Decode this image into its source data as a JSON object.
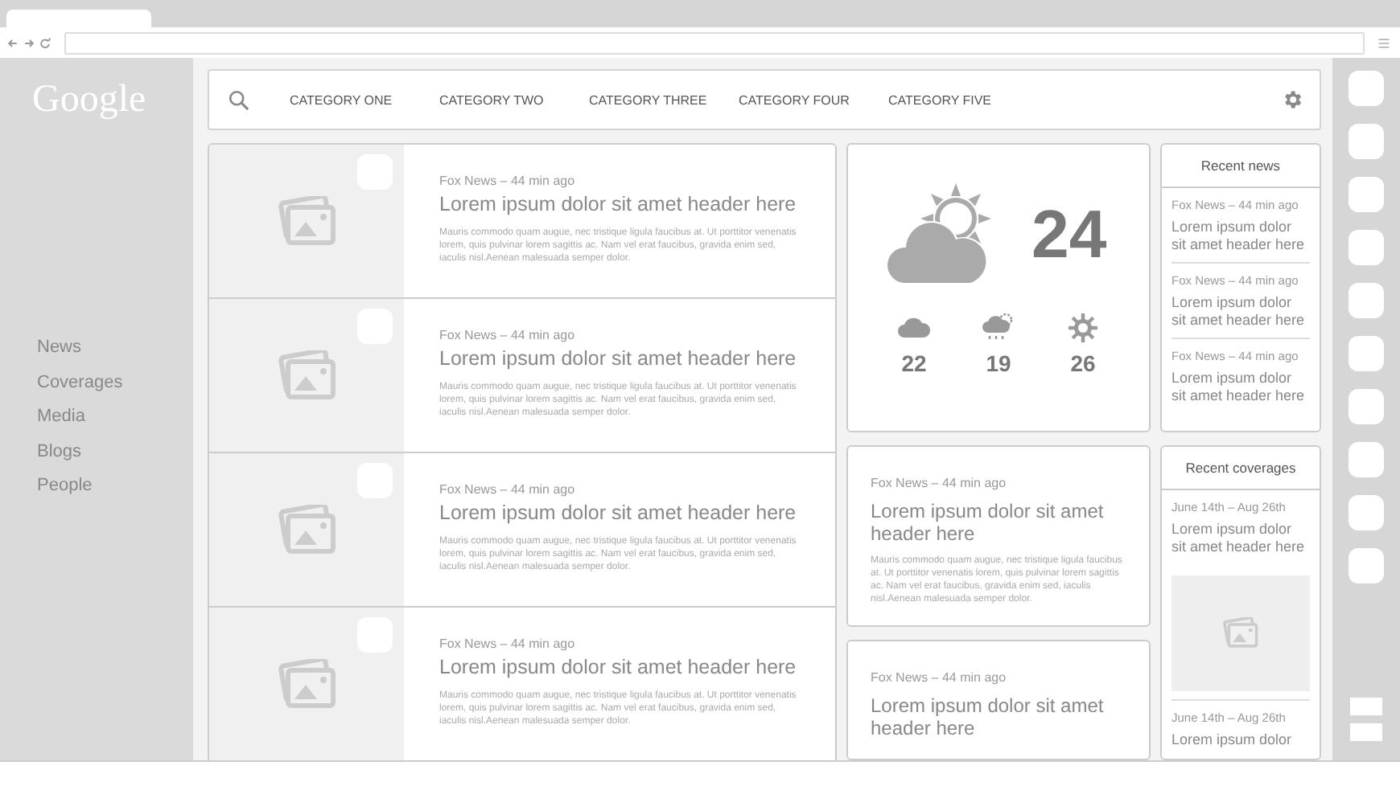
{
  "logo": "Google",
  "sidebar": {
    "items": [
      "News",
      "Coverages",
      "Media",
      "Blogs",
      "People"
    ]
  },
  "nav": {
    "categories": [
      "CATEGORY ONE",
      "CATEGORY TWO",
      "CATEGORY THREE",
      "CATEGORY FOUR",
      "CATEGORY FIVE"
    ]
  },
  "articles": [
    {
      "meta": "Fox News – 44 min ago",
      "title": "Lorem ipsum dolor sit amet header here",
      "body": "Mauris commodo quam augue, nec tristique ligula faucibus at. Ut porttitor venenatis lorem, quis pulvinar lorem sagittis ac. Nam vel erat faucibus,  gravida enim sed, iaculis nisl.Aenean malesuada semper dolor."
    },
    {
      "meta": "Fox News – 44 min ago",
      "title": "Lorem ipsum dolor sit amet header here",
      "body": "Mauris commodo quam augue, nec tristique ligula faucibus at. Ut porttitor venenatis lorem, quis pulvinar lorem sagittis ac. Nam vel erat faucibus,  gravida enim sed, iaculis nisl.Aenean malesuada semper dolor."
    },
    {
      "meta": "Fox News – 44 min ago",
      "title": "Lorem ipsum dolor sit amet header here",
      "body": "Mauris commodo quam augue, nec tristique ligula faucibus at. Ut porttitor venenatis lorem, quis pulvinar lorem sagittis ac. Nam vel erat faucibus,  gravida enim sed, iaculis nisl.Aenean malesuada semper dolor."
    },
    {
      "meta": "Fox News – 44 min ago",
      "title": "Lorem ipsum dolor sit amet header here",
      "body": "Mauris commodo quam augue, nec tristique ligula faucibus at. Ut porttitor venenatis lorem, quis pulvinar lorem sagittis ac. Nam vel erat faucibus,  gravida enim sed, iaculis nisl.Aenean malesuada semper dolor."
    }
  ],
  "weather": {
    "current": "24",
    "forecast": [
      {
        "kind": "cloud",
        "temp": "22"
      },
      {
        "kind": "rain",
        "temp": "19"
      },
      {
        "kind": "sun",
        "temp": "26"
      }
    ]
  },
  "stories": [
    {
      "meta": "Fox News – 44 min ago",
      "title": "Lorem ipsum dolor sit amet header here",
      "body": "Mauris commodo quam augue, nec tristique ligula faucibus at. Ut porttitor venenatis lorem, quis pulvinar lorem sagittis ac. Nam vel erat faucibus, gravida enim sed, iaculis nisl.Aenean malesuada semper dolor."
    },
    {
      "meta": "Fox News – 44 min ago",
      "title": "Lorem ipsum dolor sit amet header here"
    }
  ],
  "recent_news": {
    "title": "Recent news",
    "items": [
      {
        "meta": "Fox News – 44 min ago",
        "title": "Lorem ipsum dolor sit amet header here"
      },
      {
        "meta": "Fox News – 44 min ago",
        "title": "Lorem ipsum dolor sit amet header here"
      },
      {
        "meta": "Fox News – 44 min ago",
        "title": "Lorem ipsum dolor sit amet header here"
      }
    ]
  },
  "recent_coverages": {
    "title": "Recent coverages",
    "items": [
      {
        "meta": "June 14th – Aug 26th",
        "title": "Lorem ipsum dolor sit amet header here",
        "image": true
      },
      {
        "meta": "June 14th – Aug 26th",
        "title": "Lorem ipsum dolor",
        "image": false
      }
    ]
  }
}
